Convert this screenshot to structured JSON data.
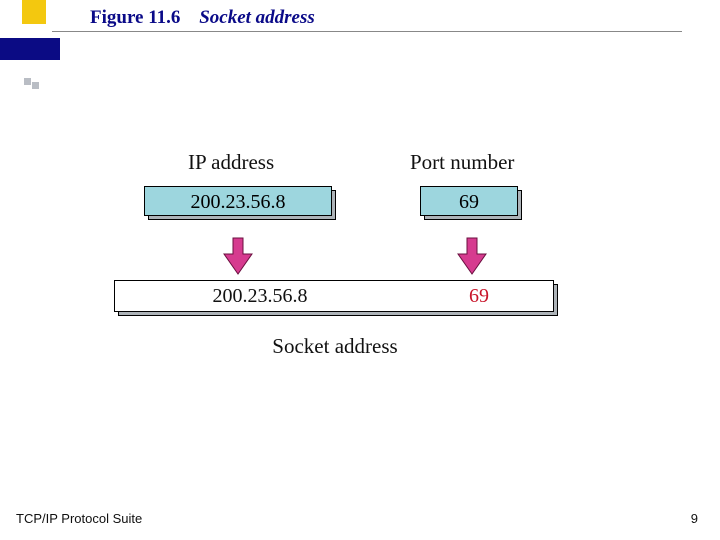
{
  "figure": {
    "number": "Figure 11.6",
    "caption": "Socket address"
  },
  "labels": {
    "ip": "IP address",
    "port": "Port number",
    "socket": "Socket address"
  },
  "values": {
    "ip": "200.23.56.8",
    "port": "69",
    "combined_ip": "200.23.56.8",
    "combined_port": "69"
  },
  "colors": {
    "accent": "#9dd6de",
    "arrow_fill": "#d63b8f",
    "arrow_edge": "#6b0f3f",
    "port_highlight": "#c8142a",
    "title": "#0a0a88"
  },
  "footer": {
    "text": "TCP/IP Protocol Suite",
    "page": "9"
  }
}
